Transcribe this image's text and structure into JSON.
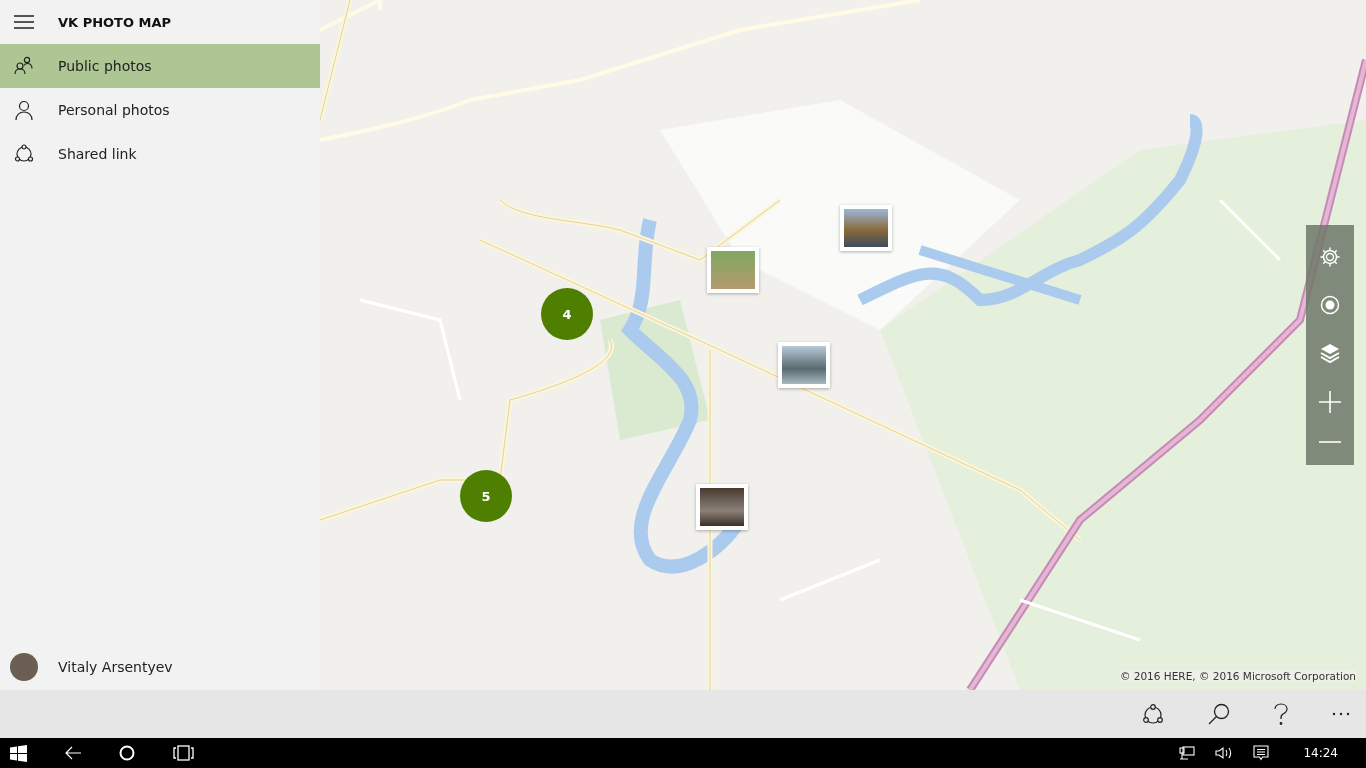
{
  "app": {
    "title": "VK PHOTO MAP"
  },
  "nav": [
    {
      "kind": "public",
      "label": "Public photos",
      "selected": true
    },
    {
      "kind": "personal",
      "label": "Personal photos",
      "selected": false
    },
    {
      "kind": "shared",
      "label": "Shared link",
      "selected": false
    }
  ],
  "user": {
    "name": "Vitaly Arsentyev"
  },
  "map": {
    "clusters": [
      {
        "count": "4"
      },
      {
        "count": "5"
      }
    ],
    "copyright": "© 2016 HERE, © 2016 Microsoft Corporation"
  },
  "taskbar": {
    "time": "14:24"
  }
}
